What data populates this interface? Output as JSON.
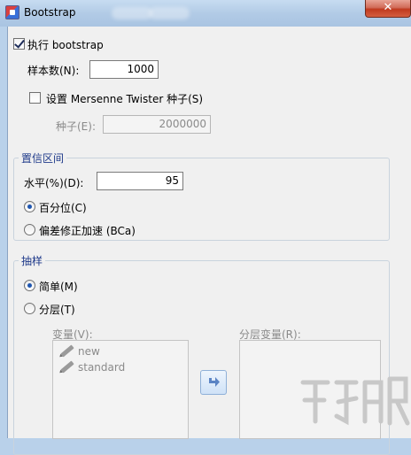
{
  "window": {
    "title": "Bootstrap",
    "close_glyph": "✕"
  },
  "perform": {
    "label": "执行 bootstrap",
    "checked": true
  },
  "samples": {
    "label": "样本数(N):",
    "value": "1000"
  },
  "seed_option": {
    "label": "设置 Mersenne Twister 种子(S)",
    "checked": false
  },
  "seed": {
    "label": "种子(E):",
    "value": "2000000"
  },
  "ci_group": {
    "title": "置信区间",
    "level_label": "水平(%)(D):",
    "level_value": "95",
    "percentile": {
      "label": "百分位(C)",
      "selected": true
    },
    "bca": {
      "label": "偏差修正加速 (BCa)",
      "selected": false
    }
  },
  "sampling_group": {
    "title": "抽样",
    "simple": {
      "label": "简单(M)",
      "selected": true
    },
    "stratified": {
      "label": "分层(T)",
      "selected": false
    },
    "variables_label": "变量(V):",
    "variables": [
      "new",
      "standard"
    ],
    "strata_label": "分层变量(R):"
  },
  "icons": {
    "app": "spss-app-icon",
    "variable": "pencil-icon",
    "move": "arrow-right-icon"
  },
  "colors": {
    "title_bar": "#b9d1ea",
    "group_title": "#1f3a8a",
    "close": "#c03a1e"
  }
}
